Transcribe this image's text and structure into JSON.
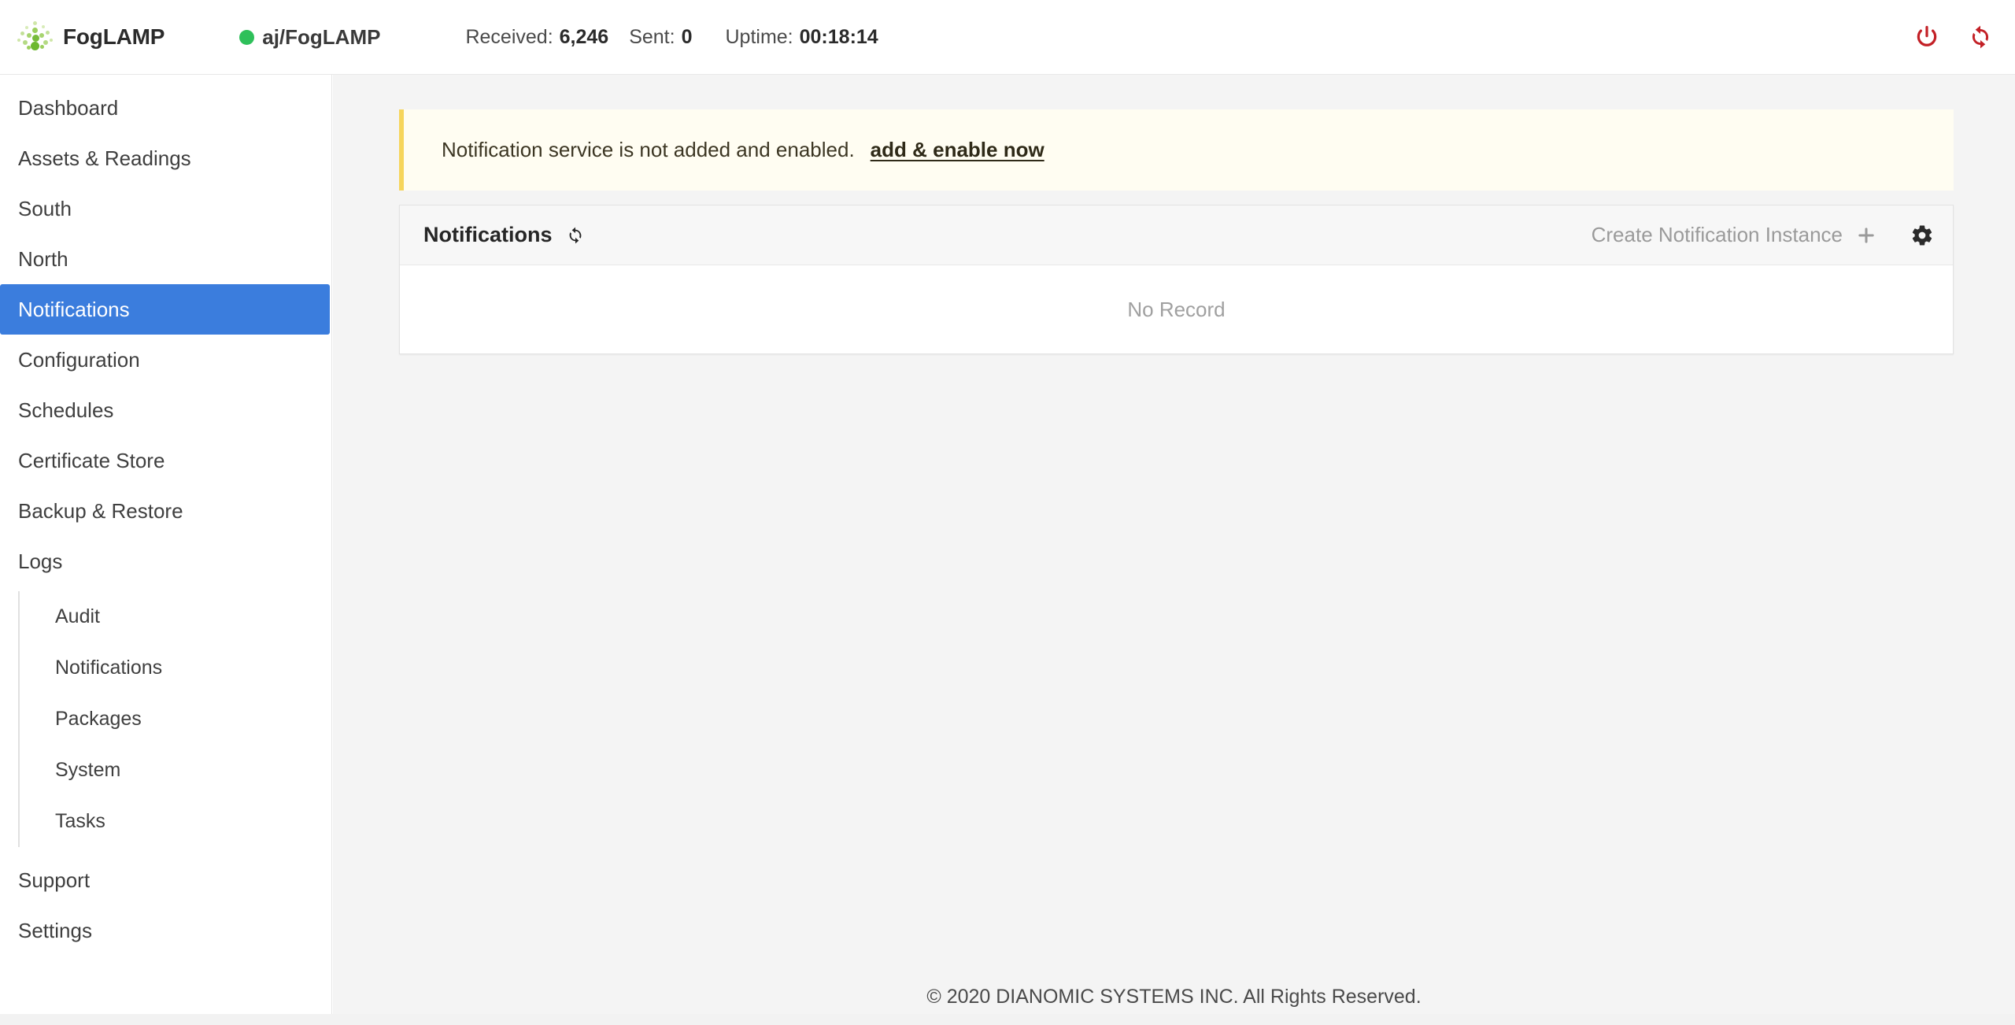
{
  "header": {
    "logo_icon": "foglamp-dots-logo",
    "brand": "FogLAMP",
    "connection": {
      "status_icon": "green-status-dot",
      "name": "aj/FogLAMP",
      "status_color": "#2ec05a"
    },
    "stats": [
      {
        "label": "Received:",
        "value": "6,246"
      },
      {
        "label": "Sent:",
        "value": "0"
      },
      {
        "label": "Uptime:",
        "value": "00:18:14"
      }
    ],
    "actions": [
      {
        "icon": "power-icon",
        "color": "#c32026"
      },
      {
        "icon": "restart-sync-icon",
        "color": "#c32026"
      }
    ]
  },
  "sidebar": {
    "items": [
      {
        "label": "Dashboard",
        "active": false
      },
      {
        "label": "Assets & Readings",
        "active": false
      },
      {
        "label": "South",
        "active": false
      },
      {
        "label": "North",
        "active": false
      },
      {
        "label": "Notifications",
        "active": true
      },
      {
        "label": "Configuration",
        "active": false
      },
      {
        "label": "Schedules",
        "active": false
      },
      {
        "label": "Certificate Store",
        "active": false
      },
      {
        "label": "Backup & Restore",
        "active": false
      },
      {
        "label": "Logs",
        "active": false
      }
    ],
    "log_subitems": [
      {
        "label": "Audit"
      },
      {
        "label": "Notifications"
      },
      {
        "label": "Packages"
      },
      {
        "label": "System"
      },
      {
        "label": "Tasks"
      }
    ],
    "footer_items": [
      {
        "label": "Support"
      },
      {
        "label": "Settings"
      }
    ],
    "active_color": "#3b7ddd"
  },
  "main": {
    "banner": {
      "message": "Notification service is not added and enabled.",
      "link_label": "add & enable now",
      "accent_color": "#f6d55c",
      "background_color": "#fffdf2"
    },
    "card": {
      "title": "Notifications",
      "refresh_icon": "refresh-sync-icon",
      "create_label": "Create Notification Instance",
      "create_icon": "plus-icon",
      "settings_icon": "gear-icon",
      "empty_text": "No Record"
    }
  },
  "footer": {
    "copyright": "© 2020 DIANOMIC SYSTEMS INC. All Rights Reserved."
  }
}
